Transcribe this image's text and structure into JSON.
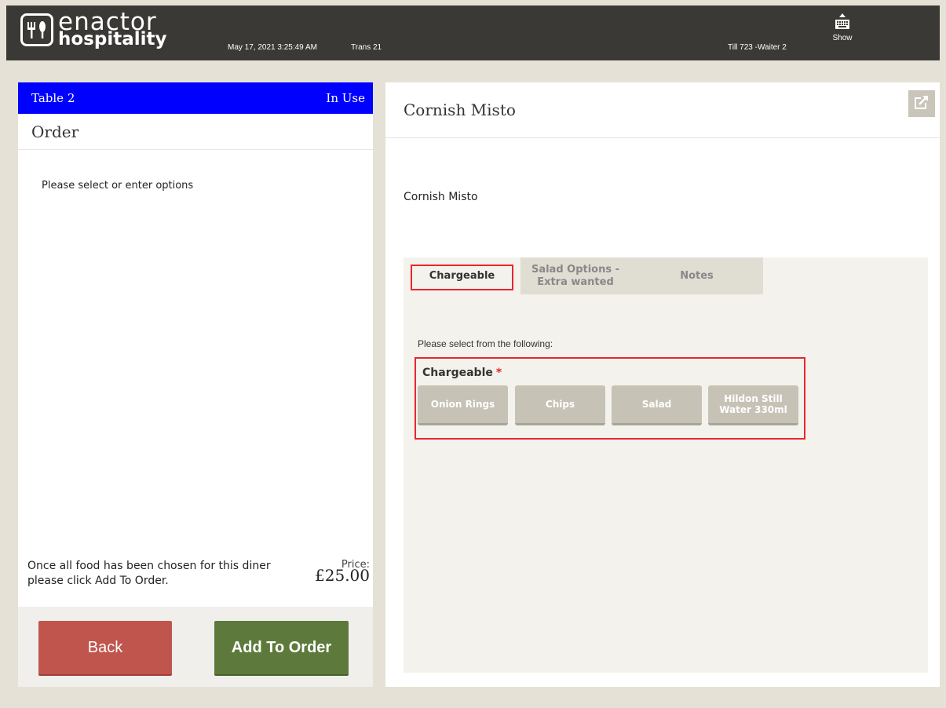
{
  "header": {
    "brand_line1": "enactor",
    "brand_line2": "hospitality",
    "datetime": "May 17, 2021 3:25:49 AM",
    "trans": "Trans 21",
    "till": "Till 723 -Waiter 2",
    "show_label": "Show"
  },
  "left": {
    "table_name": "Table 2",
    "table_status": "In Use",
    "order_title": "Order",
    "prompt": "Please select or enter options",
    "footer_msg": "Once all food has been chosen for this diner please click Add To Order.",
    "price_label": "Price:",
    "price_value": "£25.00",
    "back_label": "Back",
    "add_label": "Add To Order"
  },
  "right": {
    "title": "Cornish Misto",
    "item_name": "Cornish Misto",
    "tabs": [
      {
        "label": "Chargeable"
      },
      {
        "label": "Salad Options - Extra wanted"
      },
      {
        "label": "Notes"
      }
    ],
    "select_prompt": "Please select from the following:",
    "group_label": "Chargeable",
    "required_mark": "*",
    "options": [
      {
        "label": "Onion Rings"
      },
      {
        "label": "Chips"
      },
      {
        "label": "Salad"
      },
      {
        "label": "Hildon Still Water 330ml"
      }
    ]
  },
  "colors": {
    "table_header": "#0000ff",
    "back_button": "#c0554e",
    "add_button": "#5d7a3c",
    "highlight": "#e8262e"
  }
}
